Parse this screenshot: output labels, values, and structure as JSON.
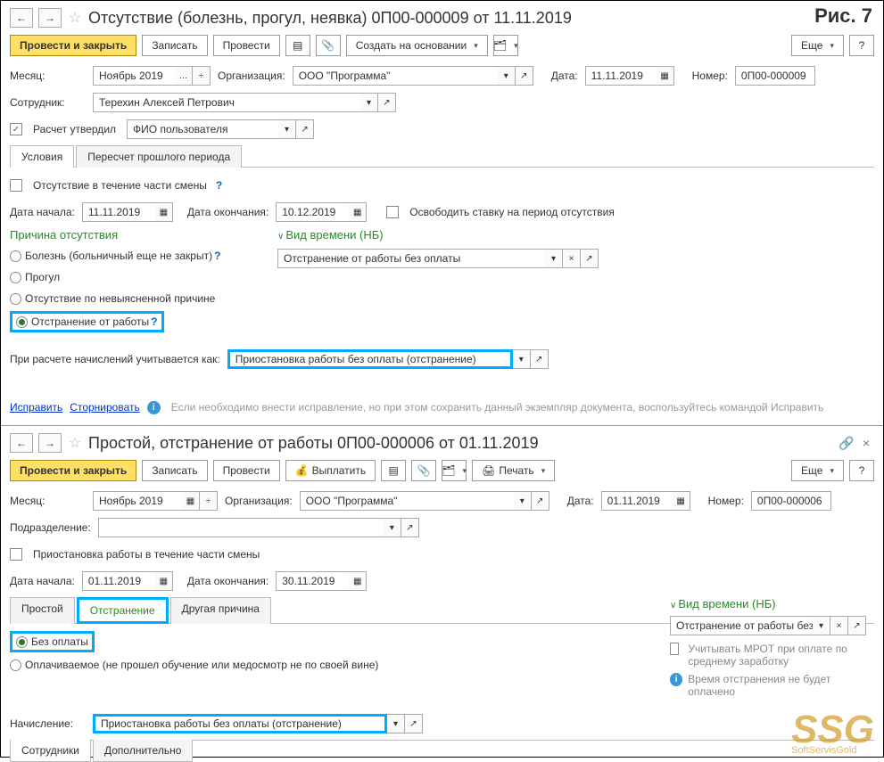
{
  "corner_label": "Рис. 7",
  "win1": {
    "title": "Отсутствие (болезнь, прогул, неявка) 0П00-000009 от 11.11.2019",
    "toolbar": {
      "post_close": "Провести и закрыть",
      "save": "Записать",
      "post": "Провести",
      "create_on_basis": "Создать на основании",
      "more": "Еще"
    },
    "month": {
      "label": "Месяц:",
      "value": "Ноябрь 2019"
    },
    "org": {
      "label": "Организация:",
      "value": "ООО \"Программа\""
    },
    "date": {
      "label": "Дата:",
      "value": "11.11.2019"
    },
    "number": {
      "label": "Номер:",
      "value": "0П00-000009"
    },
    "employee": {
      "label": "Сотрудник:",
      "value": "Терехин Алексей Петрович"
    },
    "approved": {
      "label": "Расчет утвердил",
      "value": "ФИО пользователя"
    },
    "tabs": {
      "tab1": "Условия",
      "tab2": "Пересчет прошлого периода"
    },
    "partial_shift": "Отсутствие в течение части смены",
    "date_start": {
      "label": "Дата начала:",
      "value": "11.11.2019"
    },
    "date_end": {
      "label": "Дата окончания:",
      "value": "10.12.2019"
    },
    "free_rate": "Освободить ставку на период отсутствия",
    "reason_title": "Причина отсутствия",
    "reasons": {
      "r1": "Болезнь (больничный еще не закрыт)",
      "r2": "Прогул",
      "r3": "Отсутствие по невыясненной причине",
      "r4": "Отстранение от работы"
    },
    "time_type": {
      "title": "Вид времени (НБ)",
      "value": "Отстранение от работы без оплаты"
    },
    "calc_as": {
      "label": "При расчете начислений учитывается как:",
      "value": "Приостановка работы без оплаты (отстранение)"
    },
    "fix": "Исправить",
    "reverse": "Сторнировать",
    "fix_note": "Если необходимо внести исправление, но при этом сохранить данный экземпляр документа, воспользуйтесь командой Исправить"
  },
  "win2": {
    "title": "Простой, отстранение от работы 0П00-000006 от 01.11.2019",
    "toolbar": {
      "post_close": "Провести и закрыть",
      "save": "Записать",
      "post": "Провести",
      "pay": "Выплатить",
      "print": "Печать",
      "more": "Еще"
    },
    "month": {
      "label": "Месяц:",
      "value": "Ноябрь 2019"
    },
    "org": {
      "label": "Организация:",
      "value": "ООО \"Программа\""
    },
    "date": {
      "label": "Дата:",
      "value": "01.11.2019"
    },
    "number": {
      "label": "Номер:",
      "value": "0П00-000006"
    },
    "dept": {
      "label": "Подразделение:",
      "value": ""
    },
    "partial_shift": "Приостановка работы в течение части смены",
    "date_start": {
      "label": "Дата начала:",
      "value": "01.11.2019"
    },
    "date_end": {
      "label": "Дата окончания:",
      "value": "30.11.2019"
    },
    "tabs": {
      "t1": "Простой",
      "t2": "Отстранение",
      "t3": "Другая причина"
    },
    "opt1": "Без оплаты",
    "opt2": "Оплачиваемое (не прошел обучение или медосмотр не по своей вине)",
    "time_type": {
      "title": "Вид времени (НБ)",
      "value": "Отстранение от работы без опл"
    },
    "mrot": "Учитывать МРОТ при оплате по среднему заработку",
    "info_not_paid": "Время отстранения не будет оплачено",
    "accrual": {
      "label": "Начисление:",
      "value": "Приостановка работы без оплаты (отстранение)"
    },
    "bottom_tabs": {
      "t1": "Сотрудники",
      "t2": "Дополнительно"
    }
  },
  "watermark": {
    "big": "SSG",
    "small": "SoftServisGold"
  }
}
